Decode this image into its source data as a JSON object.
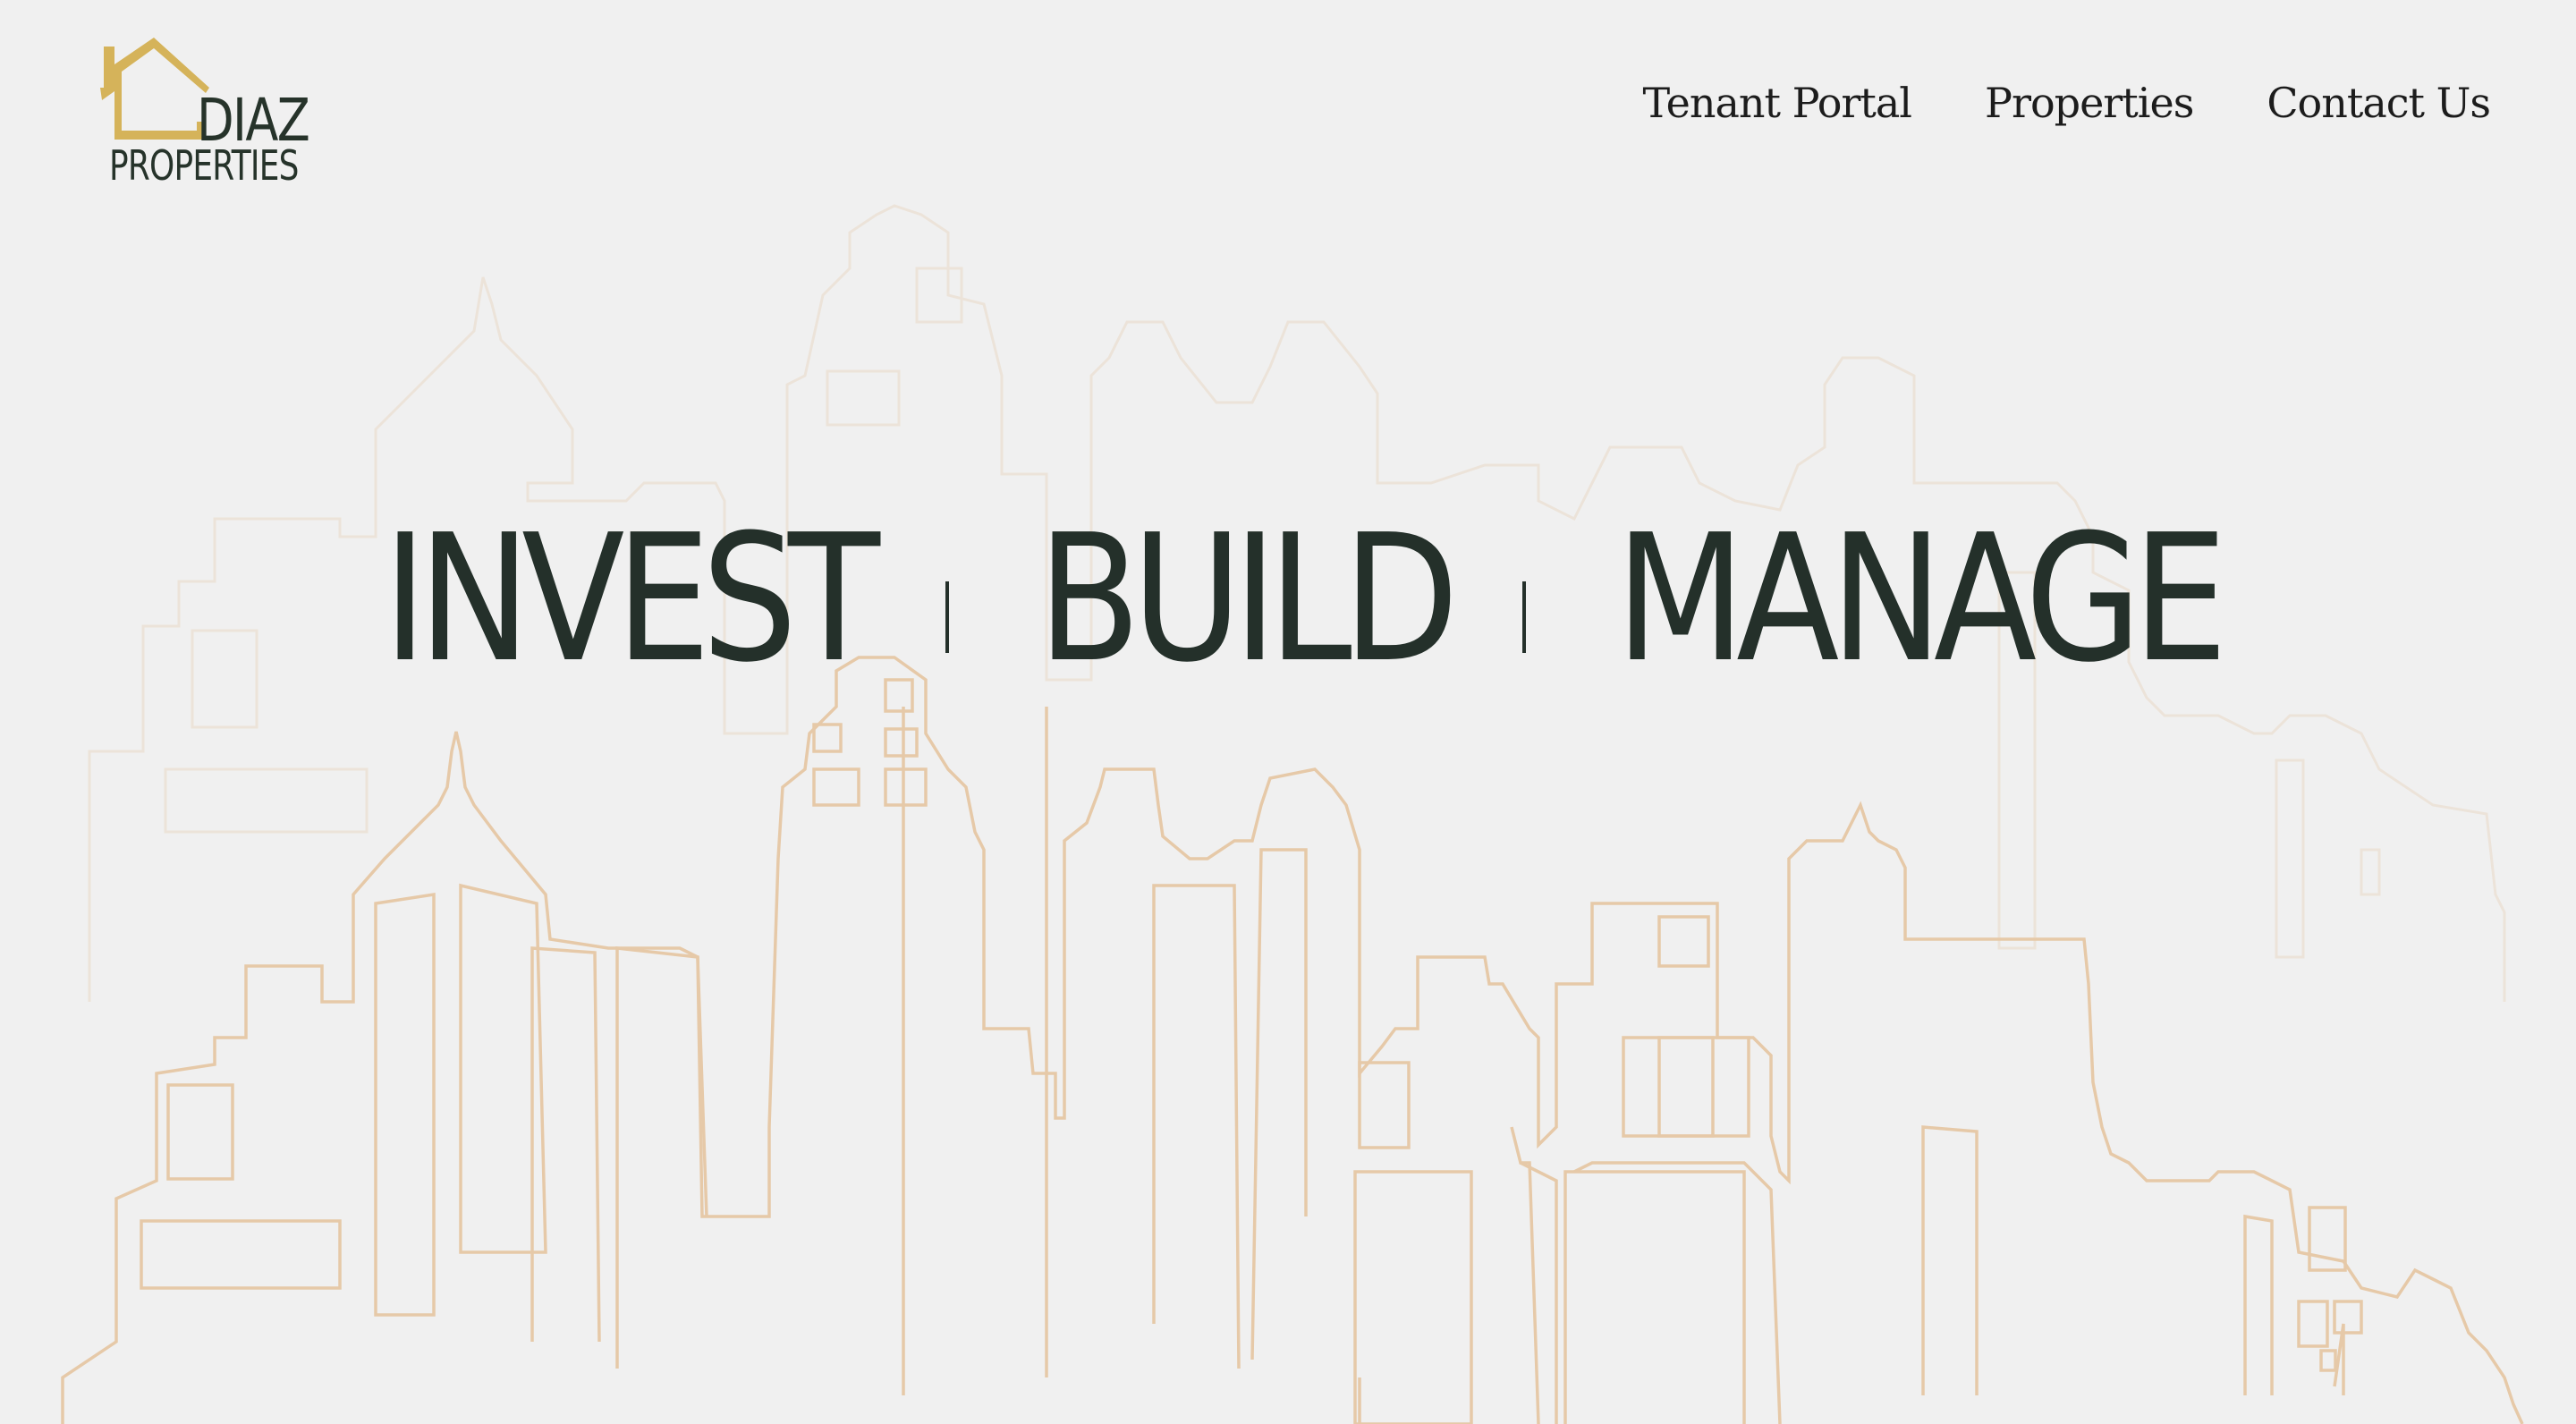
{
  "brand": {
    "name_line1": "DIAZ",
    "name_line2": "PROPERTIES",
    "house_color": "#d5b35a",
    "text_color": "#26332a"
  },
  "nav": {
    "items": [
      {
        "label": "Tenant Portal"
      },
      {
        "label": "Properties"
      },
      {
        "label": "Contact Us"
      }
    ]
  },
  "hero": {
    "words": [
      "INVEST",
      "BUILD",
      "MANAGE"
    ],
    "separator": "|"
  },
  "colors": {
    "background": "#f0f0f0",
    "skyline_front": "#e6c9a8",
    "skyline_back": "#ece3d9",
    "headline": "#24302a"
  }
}
